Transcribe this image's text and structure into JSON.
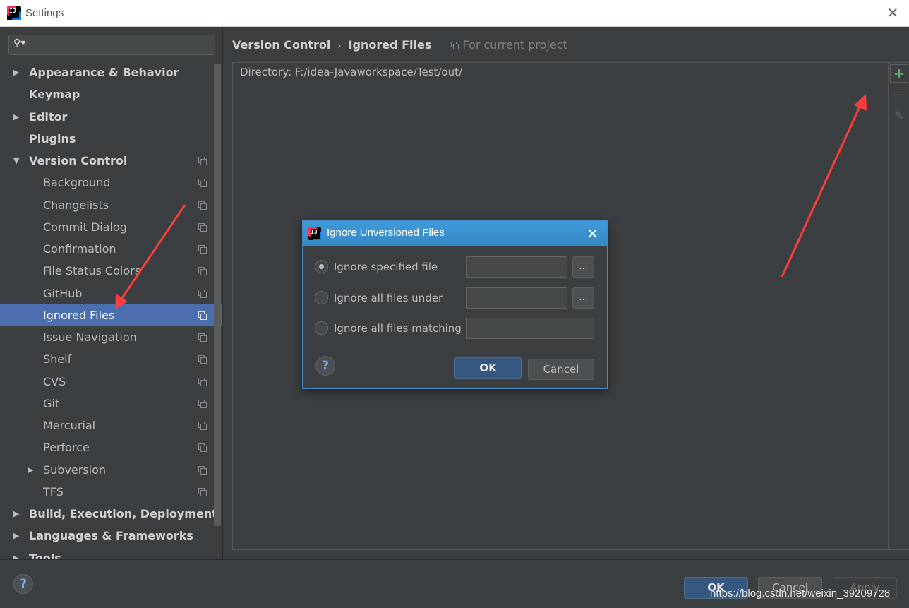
{
  "window": {
    "title": "Settings",
    "close_glyph": "✕"
  },
  "sidebar": {
    "search_placeholder": "",
    "search_icon": "search-icon",
    "items": [
      {
        "label": "Appearance & Behavior",
        "level": 0,
        "expandable": true,
        "expanded": false,
        "bold": true,
        "project_icon": false
      },
      {
        "label": "Keymap",
        "level": 0,
        "expandable": false,
        "bold": true,
        "project_icon": false
      },
      {
        "label": "Editor",
        "level": 0,
        "expandable": true,
        "expanded": false,
        "bold": true,
        "project_icon": false
      },
      {
        "label": "Plugins",
        "level": 0,
        "expandable": false,
        "bold": true,
        "project_icon": false
      },
      {
        "label": "Version Control",
        "level": 0,
        "expandable": true,
        "expanded": true,
        "bold": true,
        "project_icon": true
      },
      {
        "label": "Background",
        "level": 1,
        "project_icon": true
      },
      {
        "label": "Changelists",
        "level": 1,
        "project_icon": true
      },
      {
        "label": "Commit Dialog",
        "level": 1,
        "project_icon": true
      },
      {
        "label": "Confirmation",
        "level": 1,
        "project_icon": true
      },
      {
        "label": "File Status Colors",
        "level": 1,
        "project_icon": true
      },
      {
        "label": "GitHub",
        "level": 1,
        "project_icon": true
      },
      {
        "label": "Ignored Files",
        "level": 1,
        "project_icon": true,
        "selected": true
      },
      {
        "label": "Issue Navigation",
        "level": 1,
        "project_icon": true
      },
      {
        "label": "Shelf",
        "level": 1,
        "project_icon": true
      },
      {
        "label": "CVS",
        "level": 1,
        "project_icon": true
      },
      {
        "label": "Git",
        "level": 1,
        "project_icon": true
      },
      {
        "label": "Mercurial",
        "level": 1,
        "project_icon": true
      },
      {
        "label": "Perforce",
        "level": 1,
        "project_icon": true
      },
      {
        "label": "Subversion",
        "level": 1,
        "expandable": true,
        "expanded": false,
        "project_icon": true
      },
      {
        "label": "TFS",
        "level": 1,
        "project_icon": true
      },
      {
        "label": "Build, Execution, Deployment",
        "level": 0,
        "expandable": true,
        "expanded": false,
        "bold": true,
        "project_icon": false
      },
      {
        "label": "Languages & Frameworks",
        "level": 0,
        "expandable": true,
        "expanded": false,
        "bold": true,
        "project_icon": false
      },
      {
        "label": "Tools",
        "level": 0,
        "expandable": true,
        "expanded": false,
        "bold": true,
        "project_icon": false
      }
    ]
  },
  "breadcrumb": {
    "parent": "Version Control",
    "separator": "›",
    "current": "Ignored Files",
    "scope": "For current project"
  },
  "ignored_list": {
    "entries": [
      "Directory: F:/idea-Javaworkspace/Test/out/"
    ]
  },
  "toolbar": {
    "add_glyph": "+",
    "remove_glyph": "—",
    "edit_glyph": "✎"
  },
  "footer": {
    "help": "?",
    "ok": "OK",
    "cancel": "Cancel",
    "apply": "Apply",
    "watermark": "https://blog.csdn.net/weixin_39209728"
  },
  "dialog": {
    "title": "Ignore Unversioned Files",
    "close_glyph": "✕",
    "options": [
      {
        "label": "Ignore specified file",
        "checked": true,
        "has_browse": true,
        "value": ""
      },
      {
        "label": "Ignore all files under",
        "checked": false,
        "has_browse": true,
        "value": ""
      },
      {
        "label": "Ignore all files matching",
        "checked": false,
        "has_browse": false,
        "value": ""
      }
    ],
    "browse_label": "...",
    "help": "?",
    "ok": "OK",
    "cancel": "Cancel"
  },
  "colors": {
    "background": "#3c3f41",
    "selection": "#4b6eaf",
    "dialog_title": "#3d8fd0",
    "default_button": "#365880",
    "add_icon": "#59a869",
    "annotation_arrow": "#ff3b3b"
  }
}
